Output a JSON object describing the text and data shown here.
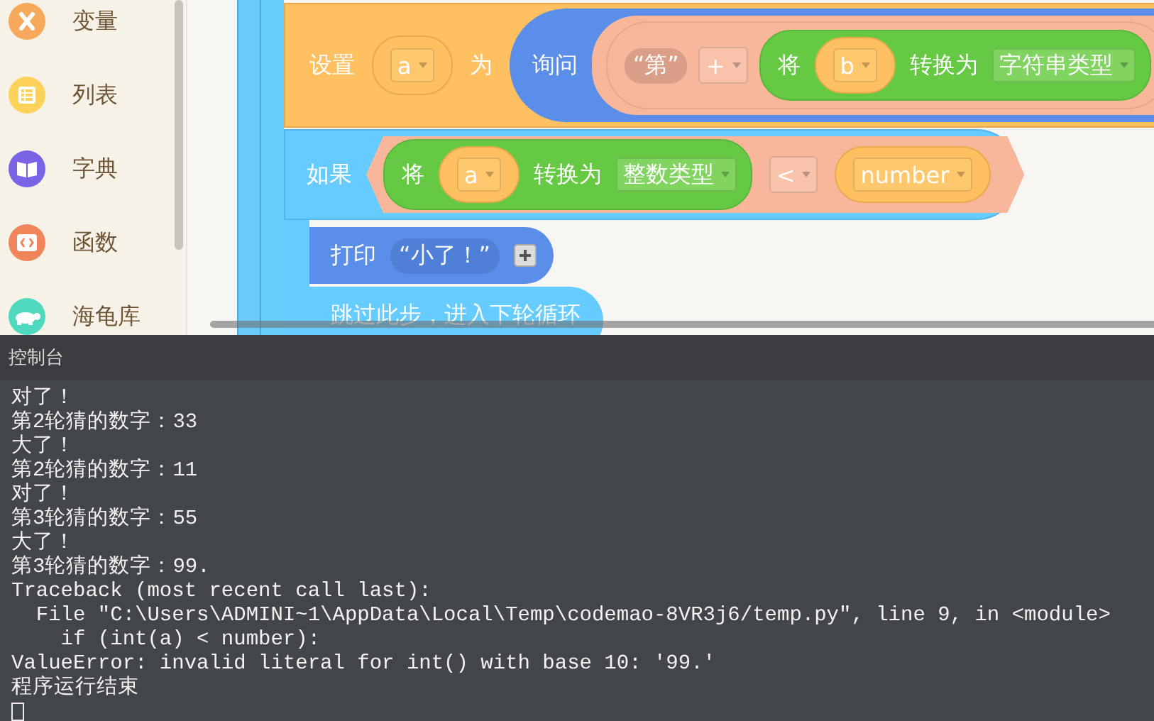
{
  "sidebar": {
    "items": [
      {
        "label": "变量",
        "color": "#f6a95a"
      },
      {
        "label": "列表",
        "color": "#fdd25a"
      },
      {
        "label": "字典",
        "color": "#7b63e6"
      },
      {
        "label": "函数",
        "color": "#f0845a"
      },
      {
        "label": "海龟库",
        "color": "#4fd9bf"
      }
    ]
  },
  "set_block": {
    "label": "设置",
    "variable": "a",
    "to_label": "为",
    "ask_label": "询问",
    "prompt_string": "“第”",
    "operator": "+",
    "convert": {
      "label": "将",
      "variable": "b",
      "to_label": "转换为",
      "type": "字符串类型"
    }
  },
  "if_block": {
    "label": "如果",
    "convert": {
      "label": "将",
      "variable": "a",
      "to_label": "转换为",
      "type": "整数类型"
    },
    "operator": "<",
    "variable": "number"
  },
  "print_block": {
    "label": "打印",
    "string": "“小了！”"
  },
  "continue_block": {
    "label": "跳过此步，进入下轮循环"
  },
  "console": {
    "title": "控制台",
    "lines": [
      "对了！",
      "第2轮猜的数字：33",
      "大了！",
      "第2轮猜的数字：11",
      "对了！",
      "第3轮猜的数字：55",
      "大了！",
      "第3轮猜的数字：99.",
      "Traceback (most recent call last):",
      "  File \"C:\\Users\\ADMINI~1\\AppData\\Local\\Temp\\codemao-8VR3j6/temp.py\", line 9, in <module>",
      "    if (int(a) < number):",
      "ValueError: invalid literal for int() with base 10: '99.'",
      "程序运行结束"
    ]
  }
}
